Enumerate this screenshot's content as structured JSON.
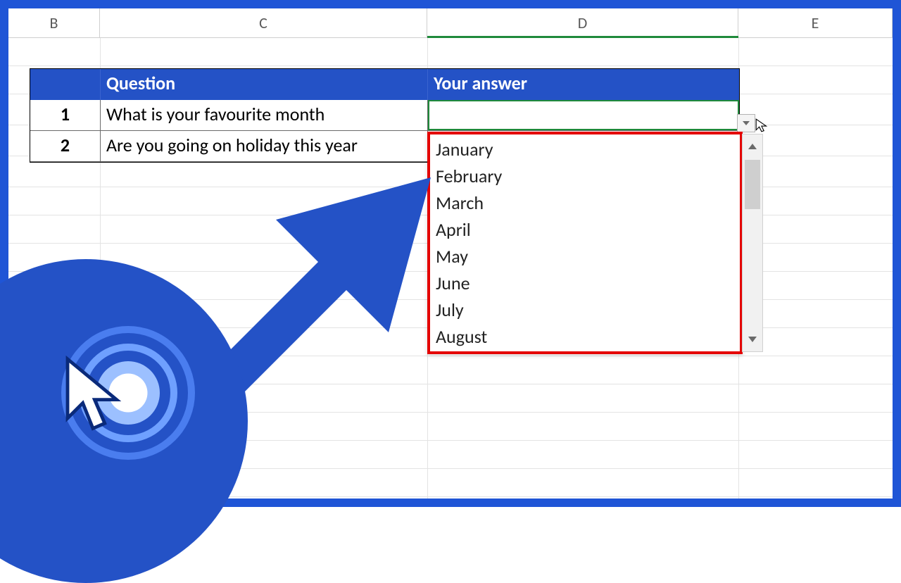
{
  "columns": {
    "b": "B",
    "c": "C",
    "d": "D",
    "e": "E"
  },
  "table": {
    "headers": {
      "num": "",
      "question": "Question",
      "answer": "Your answer"
    },
    "rows": [
      {
        "num": "1",
        "question": "What is your favourite month",
        "answer": ""
      },
      {
        "num": "2",
        "question": "Are you going on holiday this year",
        "answer": ""
      }
    ]
  },
  "dropdown": {
    "items": [
      "January",
      "February",
      "March",
      "April",
      "May",
      "June",
      "July",
      "August"
    ]
  },
  "colors": {
    "frame": "#1f55d6",
    "header_bg": "#2452c6",
    "highlight_border": "#e40000",
    "active_col": "#1f8a3b"
  }
}
